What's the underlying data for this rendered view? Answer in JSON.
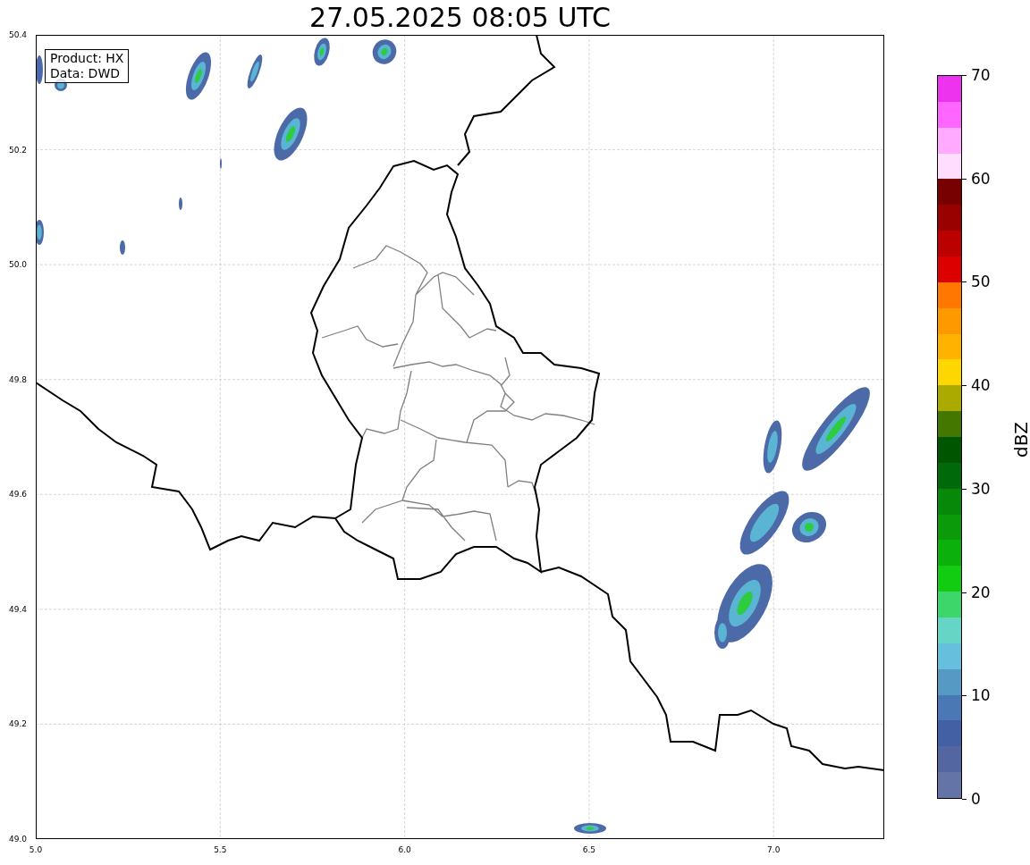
{
  "title": "27.05.2025 08:05 UTC",
  "annotation": [
    "Product: HX",
    "Data: DWD"
  ],
  "x_ticks": [
    "5.0",
    "5.5",
    "6.0",
    "6.5",
    "7.0"
  ],
  "y_ticks": [
    "50.4",
    "50.2",
    "50.0",
    "49.8",
    "49.6",
    "49.4",
    "49.2",
    "49.0"
  ],
  "colorbar": {
    "label": "dBZ",
    "ticks": [
      "70",
      "60",
      "50",
      "40",
      "30",
      "20",
      "10",
      "0"
    ],
    "bins": [
      {
        "color": "#ee33ee"
      },
      {
        "color": "#ff66ff"
      },
      {
        "color": "#ffaaff"
      },
      {
        "color": "#ffddff"
      },
      {
        "color": "#770000"
      },
      {
        "color": "#990000"
      },
      {
        "color": "#bb0000"
      },
      {
        "color": "#dd0000"
      },
      {
        "color": "#ff7700"
      },
      {
        "color": "#ff9900"
      },
      {
        "color": "#ffb300"
      },
      {
        "color": "#ffd700"
      },
      {
        "color": "#aaaa00"
      },
      {
        "color": "#447700"
      },
      {
        "color": "#005500"
      },
      {
        "color": "#006a0a"
      },
      {
        "color": "#088808"
      },
      {
        "color": "#0a9a0a"
      },
      {
        "color": "#0cb00c"
      },
      {
        "color": "#11cc11"
      },
      {
        "color": "#3dd66a"
      },
      {
        "color": "#66d5c5"
      },
      {
        "color": "#66c0dd"
      },
      {
        "color": "#5599c4"
      },
      {
        "color": "#4a78b4"
      },
      {
        "color": "#4460a4"
      },
      {
        "color": "#5466a2"
      },
      {
        "color": "#6474a6"
      }
    ]
  }
}
